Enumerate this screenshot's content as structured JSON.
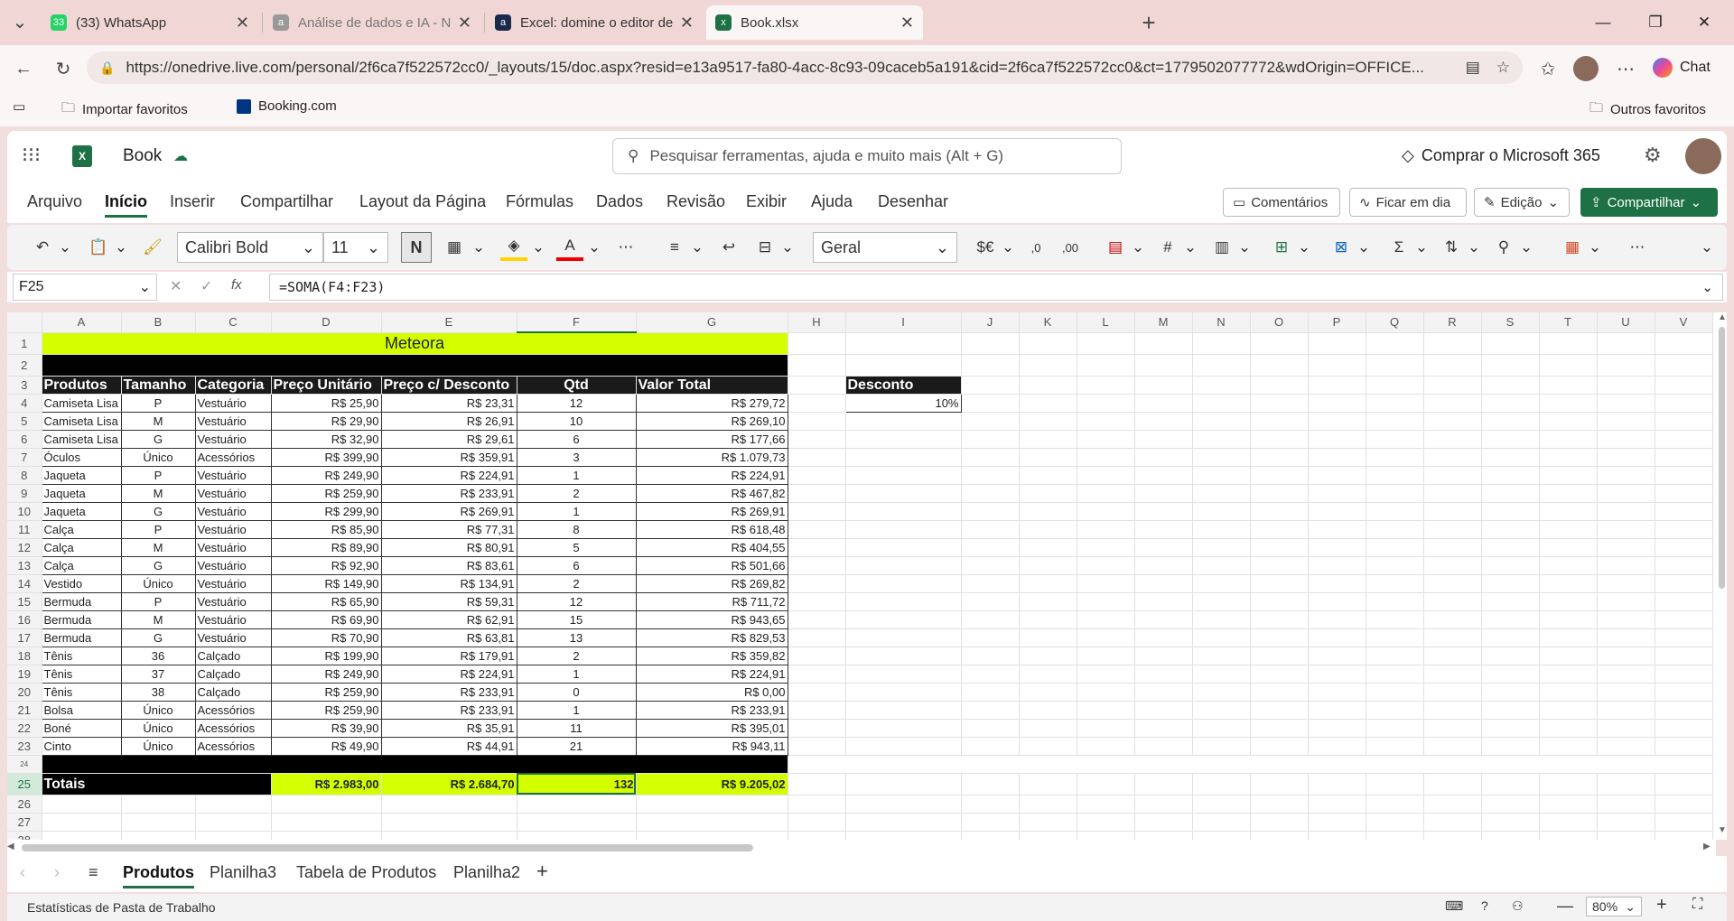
{
  "browser": {
    "tabs": [
      {
        "title": "(33) WhatsApp",
        "favicon": "whatsapp-icon",
        "favicon_text": "33"
      },
      {
        "title": "Análise de dados e IA - Nivelamen",
        "favicon": "a-icon",
        "favicon_text": "a"
      },
      {
        "title": "Excel: domine o editor de planilhas",
        "favicon": "a-icon",
        "favicon_text": "a"
      },
      {
        "title": "Book.xlsx",
        "favicon": "excel-icon",
        "favicon_text": "x"
      }
    ],
    "url": "https://onedrive.live.com/personal/2f6ca7f522572cc0/_layouts/15/doc.aspx?resid=e13a9517-fa80-4acc-8c93-09caceb5a191&cid=2f6ca7f522572cc0&ct=1779502077772&wdOrigin=OFFICE...",
    "chat_label": "Chat",
    "favorites": {
      "import": "Importar favoritos",
      "booking": "Booking.com",
      "other": "Outros favoritos"
    }
  },
  "app": {
    "doc_name": "Book",
    "search_placeholder": "Pesquisar ferramentas, ajuda e muito mais (Alt + G)",
    "buy": "Comprar o Microsoft 365"
  },
  "menu": {
    "items": [
      "Arquivo",
      "Início",
      "Inserir",
      "Compartilhar",
      "Layout da Página",
      "Fórmulas",
      "Dados",
      "Revisão",
      "Exibir",
      "Ajuda",
      "Desenhar"
    ],
    "comments": "Comentários",
    "catchup": "Ficar em dia",
    "edit": "Edição",
    "share": "Compartilhar"
  },
  "ribbon": {
    "font": "Calibri Bold",
    "size": "11",
    "bold": "N",
    "format": "Geral"
  },
  "formula": {
    "cell": "F25",
    "value": "=SOMA(F4:F23)",
    "fx": "fx"
  },
  "columns": [
    "A",
    "B",
    "C",
    "D",
    "E",
    "F",
    "G",
    "H",
    "I",
    "J",
    "K",
    "L",
    "M",
    "N",
    "O",
    "P",
    "Q",
    "R",
    "S",
    "T",
    "U",
    "V"
  ],
  "sheet": {
    "title": "Meteora",
    "headers": [
      "Produtos",
      "Tamanho",
      "Categoria",
      "Preço Unitário",
      "Preço c/ Desconto",
      "Qtd",
      "Valor Total"
    ],
    "rows": [
      [
        "Camiseta Lisa",
        "P",
        "Vestuário",
        "R$ 25,90",
        "R$ 23,31",
        "12",
        "R$ 279,72"
      ],
      [
        "Camiseta Lisa",
        "M",
        "Vestuário",
        "R$ 29,90",
        "R$ 26,91",
        "10",
        "R$ 269,10"
      ],
      [
        "Camiseta Lisa",
        "G",
        "Vestuário",
        "R$ 32,90",
        "R$ 29,61",
        "6",
        "R$ 177,66"
      ],
      [
        "Óculos",
        "Único",
        "Acessórios",
        "R$ 399,90",
        "R$ 359,91",
        "3",
        "R$ 1.079,73"
      ],
      [
        "Jaqueta",
        "P",
        "Vestuário",
        "R$ 249,90",
        "R$ 224,91",
        "1",
        "R$ 224,91"
      ],
      [
        "Jaqueta",
        "M",
        "Vestuário",
        "R$ 259,90",
        "R$ 233,91",
        "2",
        "R$ 467,82"
      ],
      [
        "Jaqueta",
        "G",
        "Vestuário",
        "R$ 299,90",
        "R$ 269,91",
        "1",
        "R$ 269,91"
      ],
      [
        "Calça",
        "P",
        "Vestuário",
        "R$ 85,90",
        "R$ 77,31",
        "8",
        "R$ 618,48"
      ],
      [
        "Calça",
        "M",
        "Vestuário",
        "R$ 89,90",
        "R$ 80,91",
        "5",
        "R$ 404,55"
      ],
      [
        "Calça",
        "G",
        "Vestuário",
        "R$ 92,90",
        "R$ 83,61",
        "6",
        "R$ 501,66"
      ],
      [
        "Vestido",
        "Único",
        "Vestuário",
        "R$ 149,90",
        "R$ 134,91",
        "2",
        "R$ 269,82"
      ],
      [
        "Bermuda",
        "P",
        "Vestuário",
        "R$ 65,90",
        "R$ 59,31",
        "12",
        "R$ 711,72"
      ],
      [
        "Bermuda",
        "M",
        "Vestuário",
        "R$ 69,90",
        "R$ 62,91",
        "15",
        "R$ 943,65"
      ],
      [
        "Bermuda",
        "G",
        "Vestuário",
        "R$ 70,90",
        "R$ 63,81",
        "13",
        "R$ 829,53"
      ],
      [
        "Tênis",
        "36",
        "Calçado",
        "R$ 199,90",
        "R$ 179,91",
        "2",
        "R$ 359,82"
      ],
      [
        "Tênis",
        "37",
        "Calçado",
        "R$ 249,90",
        "R$ 224,91",
        "1",
        "R$ 224,91"
      ],
      [
        "Tênis",
        "38",
        "Calçado",
        "R$ 259,90",
        "R$ 233,91",
        "0",
        "R$ 0,00"
      ],
      [
        "Bolsa",
        "Único",
        "Acessórios",
        "R$ 259,90",
        "R$ 233,91",
        "1",
        "R$ 233,91"
      ],
      [
        "Boné",
        "Único",
        "Acessórios",
        "R$ 39,90",
        "R$ 35,91",
        "11",
        "R$ 395,01"
      ],
      [
        "Cinto",
        "Único",
        "Acessórios",
        "R$ 49,90",
        "R$ 44,91",
        "21",
        "R$ 943,11"
      ]
    ],
    "totals": {
      "label": "Totais",
      "unit": "R$ 2.983,00",
      "discount": "R$ 2.684,70",
      "qty": "132",
      "total": "R$ 9.205,02"
    },
    "discount_label": "Desconto",
    "discount_value": "10%"
  },
  "sheets": [
    "Produtos",
    "Planilha3",
    "Tabela de Produtos",
    "Planilha2"
  ],
  "status": {
    "text": "Estatísticas de Pasta de Trabalho",
    "zoom": "80%"
  }
}
